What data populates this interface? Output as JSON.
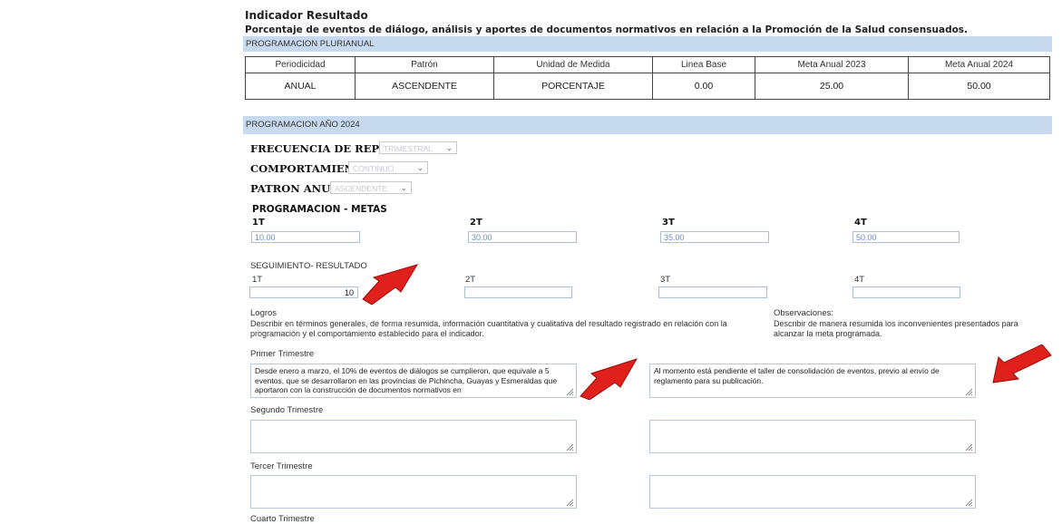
{
  "header": {
    "title": "Indicador Resultado",
    "subtitle": "Porcentaje de eventos de diálogo, análisis y aportes de documentos normativos en relación a la Promoción de la Salud consensuados."
  },
  "plurianual": {
    "bar": "PROGRAMACION PLURIANUAL",
    "headers": [
      "Periodicidad",
      "Patrón",
      "Unidad de Medida",
      "Linea Base",
      "Meta Anual 2023",
      "Meta Anual 2024"
    ],
    "values": [
      "ANUAL",
      "ASCENDENTE",
      "PORCENTAJE",
      "0.00",
      "25.00",
      "50.00"
    ]
  },
  "prog2024": {
    "bar": "PROGRAMACION AÑO 2024",
    "frecuencia_label": "FRECUENCIA DE REPORTE",
    "frecuencia_value": "TRIMESTRAL",
    "comportamiento_label": "COMPORTAMIENTO:",
    "comportamiento_value": "CONTINUO",
    "patron_label": "PATRON ANUAL:",
    "patron_value": "ASCENDENTE"
  },
  "metas": {
    "title": "PROGRAMACION - METAS",
    "quarters": [
      "1T",
      "2T",
      "3T",
      "4T"
    ],
    "values": [
      "10.00",
      "30.00",
      "35.00",
      "50.00"
    ]
  },
  "seguimiento": {
    "title": "SEGUIMIENTO- RESULTADO",
    "quarters": [
      "1T",
      "2T",
      "3T",
      "4T"
    ],
    "values": [
      "10",
      "",
      "",
      ""
    ]
  },
  "logros": {
    "title": "Logros",
    "description": "Describir en términos generales, de forma resumida, información cuantitativa y cualitativa del resultado registrado en relación con la programación y el comportamiento establecido para el indicador."
  },
  "observaciones": {
    "title": "Observaciones:",
    "description": "Describir de manera resumida los inconvenientes presentados para alcanzar la meta programada."
  },
  "trimestres": {
    "primer": "Primer Trimestre",
    "segundo": "Segundo Trimestre",
    "tercer": "Tercer Trimestre",
    "cuarto": "Cuarto Trimestre"
  },
  "primer_logros_text": "Desde enero a marzo, el 10% de eventos de diálogos se cumplieron, que equivale a 5 eventos, que se desarrollaron en las provincias de Pichincha, Guayas y Esmeraldas que aportaron con la construcción de documentos normativos en",
  "primer_obs_text": "Al momento está pendiente el taller de consolidación de eventos, previo al envío de reglamento para su publicación.",
  "colors": {
    "bar_bg": "#c7d9ef",
    "arrow": "#e0201a",
    "input_border": "#a9c0d8",
    "input_text": "#6a8fb8"
  },
  "icons": [
    "chevron-down-icon",
    "resize-grip-icon",
    "red-arrow-icon"
  ]
}
